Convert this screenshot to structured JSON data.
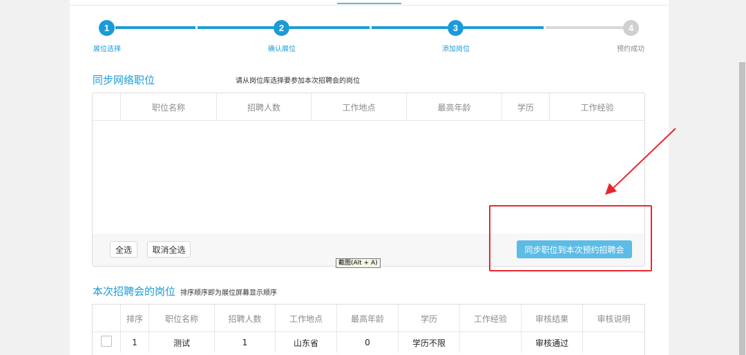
{
  "steps": [
    {
      "num": "1",
      "label": "展位选择"
    },
    {
      "num": "2",
      "label": "确认展位"
    },
    {
      "num": "3",
      "label": "添加岗位"
    },
    {
      "num": "4",
      "label": "预约成功"
    }
  ],
  "sync_section": {
    "title": "同步网络职位",
    "hint": "请从岗位库选择要参加本次招聘会的岗位",
    "columns": [
      "职位名称",
      "招聘人数",
      "工作地点",
      "最高年龄",
      "学历",
      "工作经验"
    ],
    "select_all": "全选",
    "deselect_all": "取消全选",
    "sync_button": "同步职位到本次预约招聘会"
  },
  "tooltip": "截图(Alt + A)",
  "fair_section": {
    "title": "本次招聘会的岗位",
    "hint": "排序顺序即为展位屏幕显示顺序",
    "columns": [
      "排序",
      "职位名称",
      "招聘人数",
      "工作地点",
      "最高年龄",
      "学历",
      "工作经验",
      "审核结果",
      "审核说明"
    ],
    "rows": [
      {
        "order": "1",
        "name": "测试",
        "count": "1",
        "location": "山东省",
        "max_age": "0",
        "education": "学历不限",
        "experience": "",
        "review_result": "审核通过",
        "review_note": ""
      }
    ]
  },
  "colors": {
    "accent": "#1a9bd7",
    "primary_button": "#5cbce6",
    "annotation": "#e8262e"
  }
}
